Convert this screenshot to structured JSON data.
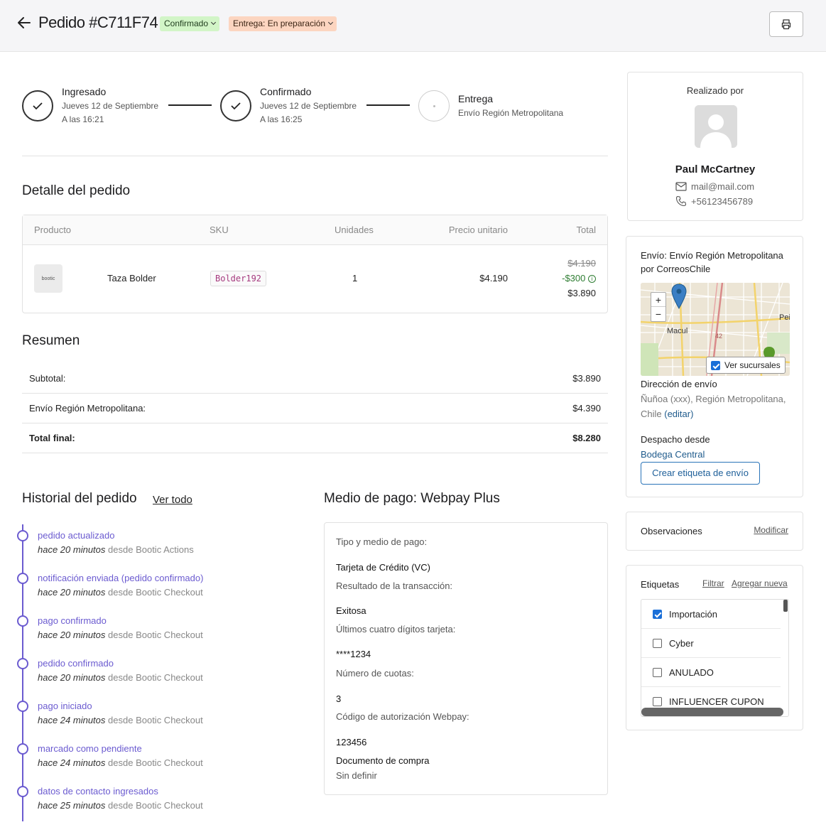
{
  "header": {
    "title": "Pedido #C711F74",
    "status_badge": "Confirmado",
    "delivery_badge": "Entrega: En preparación"
  },
  "steps": [
    {
      "title": "Ingresado",
      "line1": "Jueves 12 de Septiembre",
      "line2": "A las 16:21"
    },
    {
      "title": "Confirmado",
      "line1": "Jueves 12 de Septiembre",
      "line2": "A las 16:25"
    },
    {
      "title": "Entrega",
      "line1": "Envío Región Metropolitana"
    }
  ],
  "detail": {
    "title": "Detalle del pedido",
    "columns": [
      "Producto",
      "SKU",
      "Unidades",
      "Precio unitario",
      "Total"
    ],
    "row": {
      "image_text": "bootic",
      "name": "Taza Bolder",
      "sku": "Bolder192",
      "units": "1",
      "unit_price": "$4.190",
      "original_total": "$4.190",
      "discount": "-$300",
      "total": "$3.890"
    }
  },
  "summary": {
    "title": "Resumen",
    "rows": [
      {
        "label": "Subtotal:",
        "value": "$3.890"
      },
      {
        "label": "Envío Región Metropolitana:",
        "value": "$4.390"
      },
      {
        "label": "Total final:",
        "value": "$8.280"
      }
    ]
  },
  "history": {
    "title": "Historial del pedido",
    "link": "Ver todo",
    "items": [
      {
        "title": "pedido actualizado",
        "time": "hace 20 minutos",
        "source": "desde Bootic Actions"
      },
      {
        "title": "notificación enviada (pedido confirmado)",
        "time": "hace 20 minutos",
        "source": "desde Bootic Checkout"
      },
      {
        "title": "pago confirmado",
        "time": "hace 20 minutos",
        "source": "desde Bootic Checkout"
      },
      {
        "title": "pedido confirmado",
        "time": "hace 20 minutos",
        "source": "desde Bootic Checkout"
      },
      {
        "title": "pago iniciado",
        "time": "hace 24 minutos",
        "source": "desde Bootic Checkout"
      },
      {
        "title": "marcado como pendiente",
        "time": "hace 24 minutos",
        "source": "desde Bootic Checkout"
      },
      {
        "title": "datos de contacto ingresados",
        "time": "hace 25 minutos",
        "source": "desde Bootic Checkout"
      }
    ]
  },
  "payment": {
    "title": "Medio de pago: Webpay Plus",
    "type_label": "Tipo y medio de pago:",
    "type_value": "Tarjeta de Crédito (VC)",
    "result_label": "Resultado de la transacción:",
    "result_value": "Exitosa",
    "digits_label": "Últimos cuatro dígitos tarjeta:",
    "digits_value": "****1234",
    "installments_label": "Número de cuotas:",
    "installments_value": "3",
    "auth_label": "Código de autorización Webpay:",
    "auth_value": "123456",
    "doc_label": "Documento de compra",
    "doc_value": "Sin definir"
  },
  "customer": {
    "heading": "Realizado por",
    "name": "Paul McCartney",
    "email": "mail@mail.com",
    "phone": "+56123456789"
  },
  "shipping": {
    "title": "Envío: Envío Región Metropolitana por CorreosChile",
    "map": {
      "zoom_in": "+",
      "zoom_out": "−",
      "label_macul": "Macul",
      "label_pe": "Pei",
      "label_42": "42",
      "ver_sucursales": "Ver sucursales"
    },
    "address_label": "Dirección de envío",
    "address_line1": "Ñuñoa (xxx), Región Metropolitana,",
    "address_line2": "Chile",
    "edit_link": "(editar)",
    "from_label": "Despacho desde",
    "from_value": "Bodega Central",
    "button": "Crear etiqueta de envío"
  },
  "observations": {
    "title": "Observaciones",
    "link": "Modificar"
  },
  "tags": {
    "title": "Etiquetas",
    "filter": "Filtrar",
    "add": "Agregar nueva",
    "items": [
      {
        "label": "Importación",
        "checked": true
      },
      {
        "label": "Cyber",
        "checked": false
      },
      {
        "label": "ANULADO",
        "checked": false
      },
      {
        "label": "INFLUENCER CUPON",
        "checked": false
      }
    ]
  }
}
